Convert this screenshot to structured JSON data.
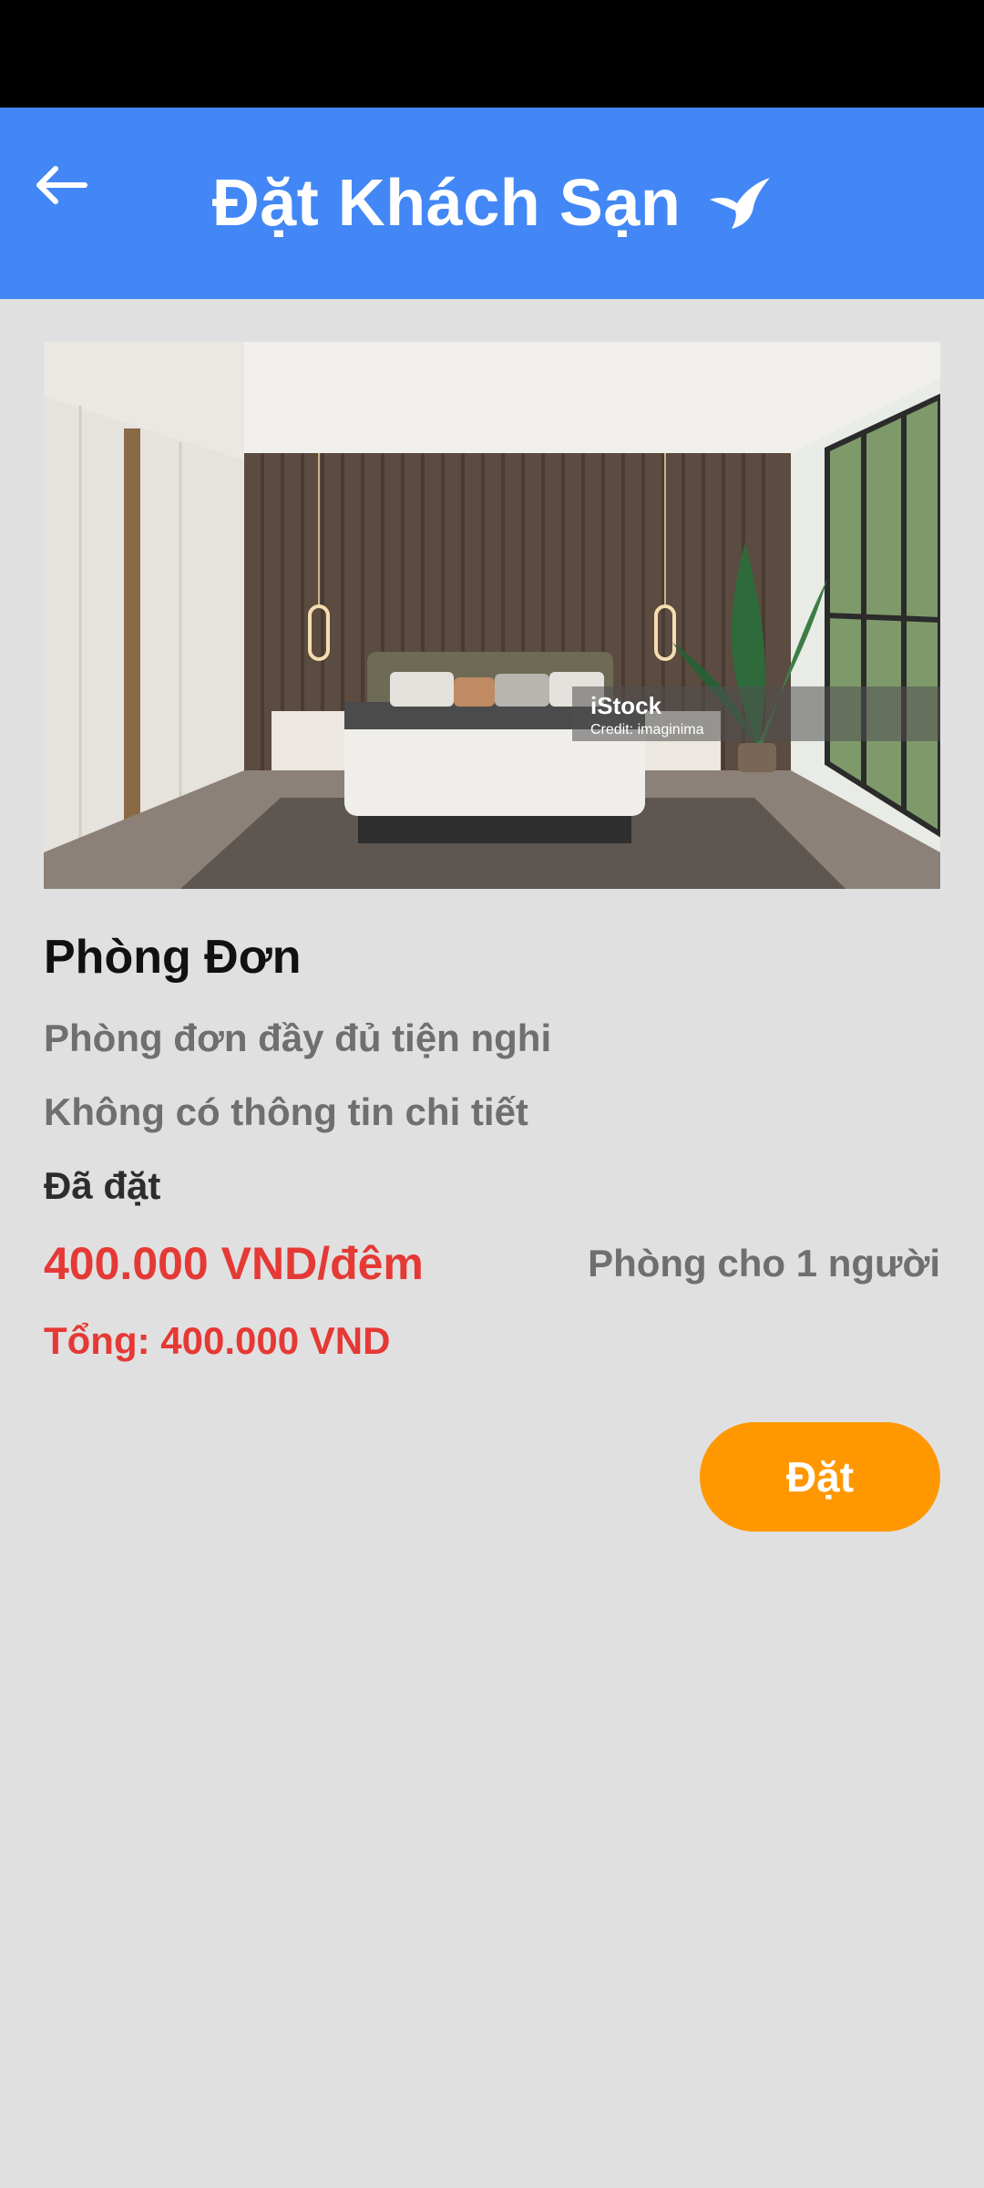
{
  "header": {
    "title": "Đặt Khách Sạn",
    "bg_color": "#4287f5"
  },
  "icons": {
    "back": "arrow-left-icon",
    "logo": "bird-icon"
  },
  "room": {
    "watermark_brand": "iStock",
    "watermark_credit": "Credit: imaginima",
    "name": "Phòng Đơn",
    "description": "Phòng đơn đầy đủ tiện nghi",
    "detail": "Không có thông tin chi tiết",
    "status": "Đã đặt",
    "price": "400.000 VND/đêm",
    "capacity": "Phòng cho 1 người",
    "total": "Tổng: 400.000 VND"
  },
  "actions": {
    "book_label": "Đặt",
    "book_color": "#ff9800"
  },
  "colors": {
    "price": "#e53935",
    "background": "#e0e0e0"
  }
}
